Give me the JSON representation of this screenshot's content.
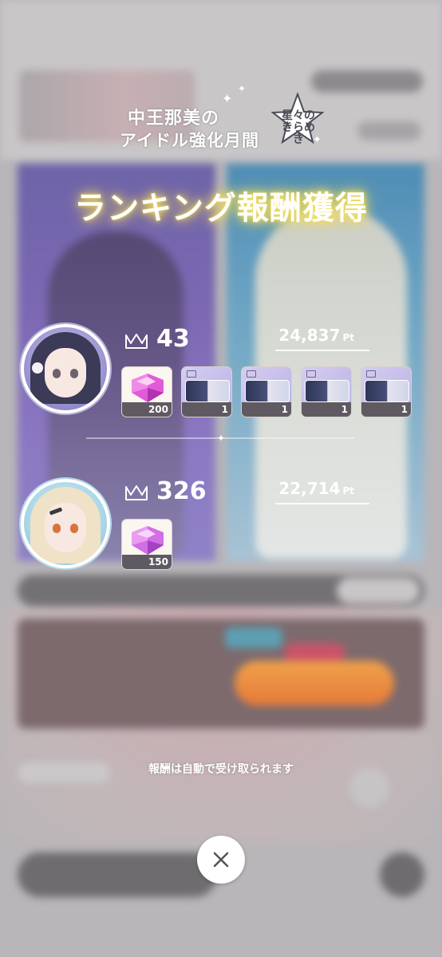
{
  "event": {
    "logo_line1": "中王那美の",
    "logo_line2": "アイドル強化月間",
    "logo_badge": "星々のきらめき"
  },
  "banner": {
    "title": "ランキング報酬獲得"
  },
  "rankings": [
    {
      "rank": "43",
      "points": "24,837",
      "points_unit": "Pt",
      "avatar_icon": "idol-avatar-dark-hair",
      "rewards": [
        {
          "icon": "pink-gem-icon",
          "qty": "200"
        },
        {
          "icon": "ticket-icon",
          "qty": "1"
        },
        {
          "icon": "ticket-icon",
          "qty": "1"
        },
        {
          "icon": "ticket-icon",
          "qty": "1"
        },
        {
          "icon": "ticket-icon",
          "qty": "1"
        }
      ]
    },
    {
      "rank": "326",
      "points": "22,714",
      "points_unit": "Pt",
      "avatar_icon": "idol-avatar-blonde-hair",
      "rewards": [
        {
          "icon": "pink-gem-icon",
          "qty": "150"
        }
      ]
    }
  ],
  "notice": "報酬は自動で受け取られます",
  "close": {
    "icon": "close-icon"
  },
  "colors": {
    "glow": "#f1d94c",
    "qty_bar": "#5f5a62",
    "overlay_bg": "#b8b6b9"
  }
}
